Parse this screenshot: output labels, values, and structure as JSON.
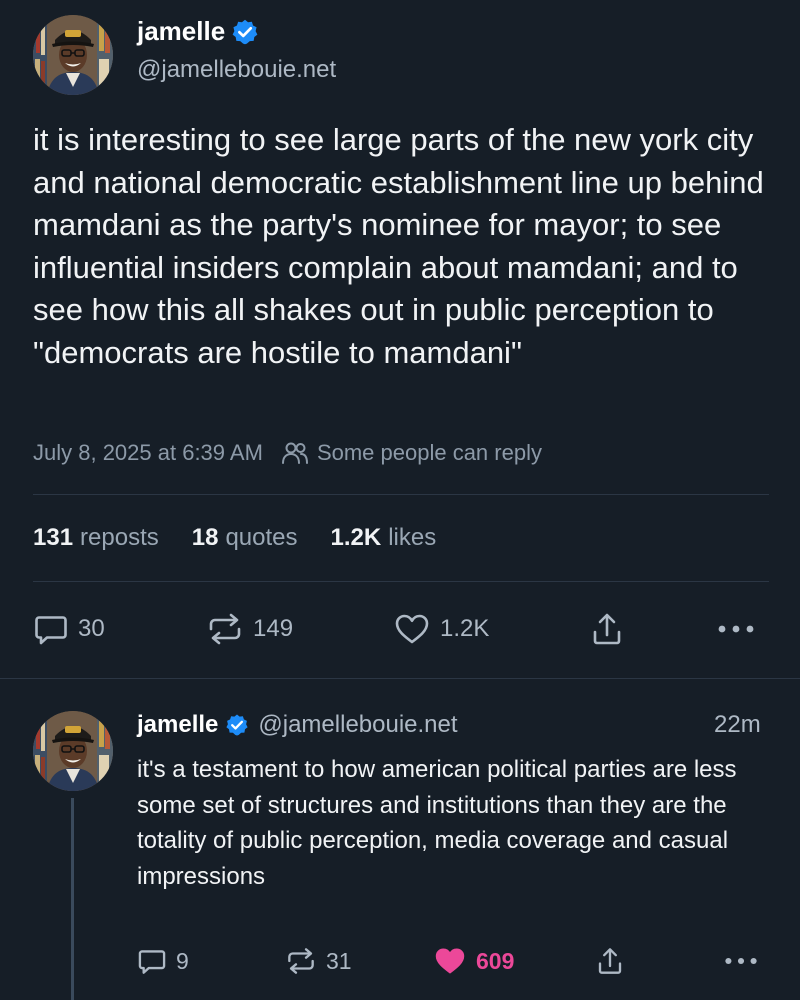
{
  "post": {
    "author": {
      "name": "jamelle",
      "handle": "@jamellebouie.net",
      "verified": true
    },
    "text": "it is interesting to see large parts of the new york city and national democratic establishment line up behind mamdani as the party's nominee for mayor; to see influential insiders complain about mamdani; and to see how this all shakes out in public perception to \"democrats are hostile to mamdani\"",
    "timestamp": "July 8, 2025 at 6:39 AM",
    "reply_setting": "Some people can reply",
    "stats": {
      "reposts": {
        "count": "131",
        "label": "reposts"
      },
      "quotes": {
        "count": "18",
        "label": "quotes"
      },
      "likes": {
        "count": "1.2K",
        "label": "likes"
      }
    },
    "actions": {
      "replies": "30",
      "reposts": "149",
      "likes": "1.2K"
    }
  },
  "reply": {
    "author": {
      "name": "jamelle",
      "handle": "@jamellebouie.net",
      "verified": true
    },
    "time_ago": "22m",
    "text": "it's a testament to how american political parties are less some set of structures and institutions than they are the totality of public perception, media coverage and casual impressions",
    "actions": {
      "replies": "9",
      "reposts": "31",
      "likes": "609",
      "liked": true
    }
  },
  "icons": {
    "verified": "verified-badge-icon",
    "reply_setting": "people-icon",
    "reply": "speech-bubble-icon",
    "repost": "repost-arrows-icon",
    "like": "heart-icon",
    "share": "share-icon",
    "more": "more-dots-icon"
  },
  "colors": {
    "background": "#161e27",
    "verified": "#1d8cf8",
    "muted_text": "#aeb9c5",
    "like_active": "#ec4899",
    "divider": "#2b3644"
  }
}
